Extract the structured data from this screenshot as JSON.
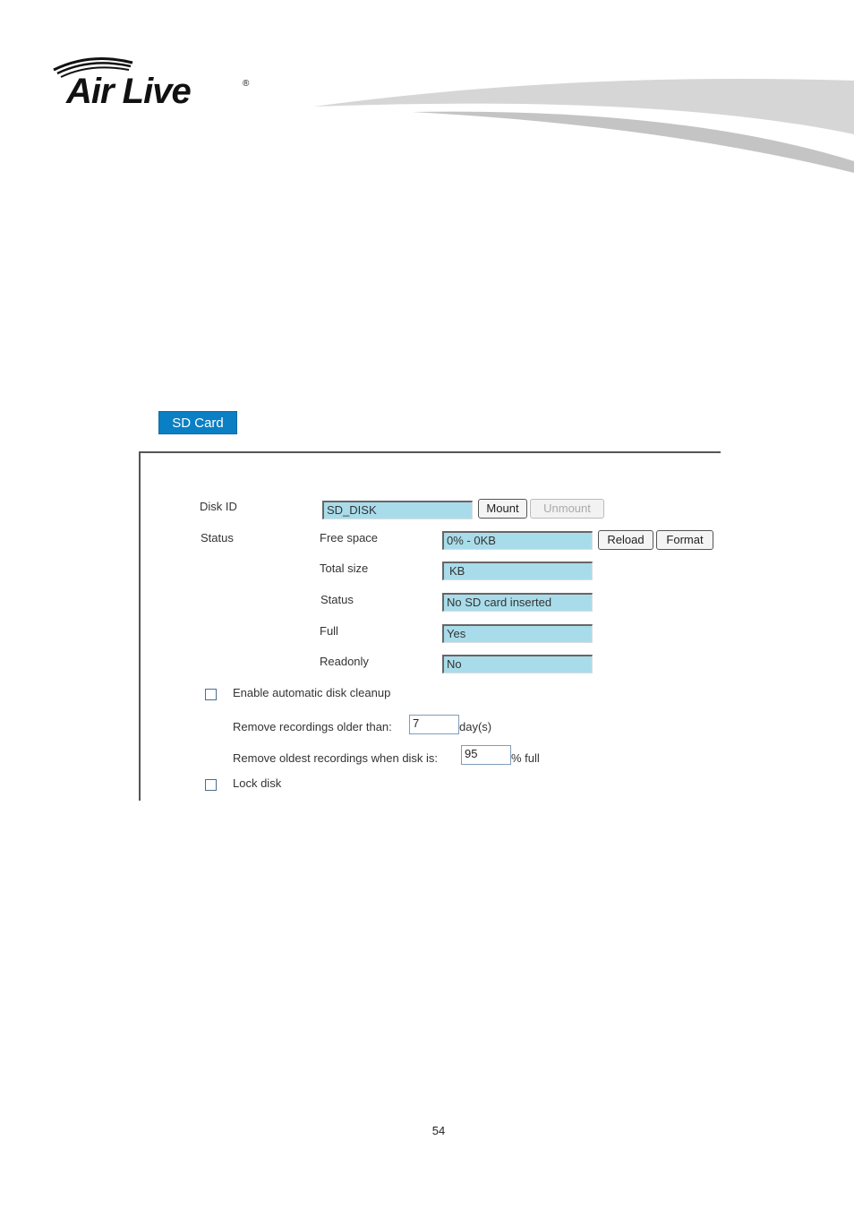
{
  "brand": {
    "logo_text": "Air Live",
    "registered_mark": "®"
  },
  "tab": {
    "label": "SD Card"
  },
  "form": {
    "disk_id_label": "Disk ID",
    "disk_id_value": "SD_DISK",
    "mount_label": "Mount",
    "unmount_label": "Unmount",
    "status_label": "Status",
    "free_space_label": "Free space",
    "free_space_value": "0% - 0KB",
    "reload_label": "Reload",
    "format_label": "Format",
    "total_size_label": "Total size",
    "total_size_value": "KB",
    "status_sub_label": "Status",
    "status_value": "No SD card inserted",
    "full_label": "Full",
    "full_value": "Yes",
    "readonly_label": "Readonly",
    "readonly_value": "No",
    "cleanup_label": "Enable automatic disk cleanup",
    "cleanup_checked": false,
    "remove_older_label": "Remove recordings older than:",
    "remove_older_value": "7",
    "remove_older_unit": "day(s)",
    "remove_full_label": "Remove oldest recordings when disk is:",
    "remove_full_value": "95",
    "remove_full_unit": "% full",
    "lock_label": "Lock disk",
    "lock_checked": false
  },
  "footer": {
    "page_number": "54"
  },
  "colors": {
    "tab_bg": "#0a7fc4",
    "field_bg": "#a9dcea"
  }
}
